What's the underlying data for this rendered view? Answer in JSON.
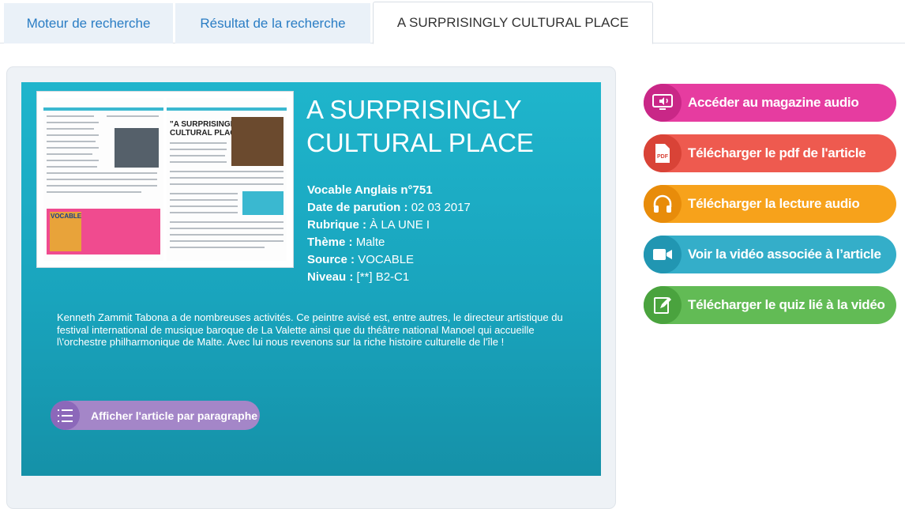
{
  "tabs": {
    "search_engine": "Moteur de recherche",
    "search_results": "Résultat de la recherche",
    "article": "A SURPRISINGLY CULTURAL PLACE"
  },
  "article": {
    "title": "A SURPRISINGLY CULTURAL PLACE",
    "meta": {
      "publication_label": "Vocable Anglais n°751",
      "date_label": "Date de parution :",
      "date_value": "02 03 2017",
      "rubric_label": "Rubrique :",
      "rubric_value": "À LA UNE I",
      "theme_label": "Thème :",
      "theme_value": "Malte",
      "source_label": "Source :",
      "source_value": "VOCABLE",
      "level_label": "Niveau :",
      "level_value": "[**] B2-C1"
    },
    "summary": "Kenneth Zammit Tabona a de nombreuses activités. Ce peintre avisé est, entre autres, le directeur artistique du festival international de musique baroque de La Valette ainsi que du théâtre national Manoel qui accueille l\\'orchestre philharmonique de Malte. Avec lui nous revenons sur la riche histoire culturelle de l'île !",
    "paragraph_button": "Afficher l'article par paragraphe",
    "thumbnail": {
      "headline_line1": "\"A SURPRISINGLY",
      "headline_line2": "CULTURAL PLACE\"",
      "mag_logo": "VOCABLE"
    }
  },
  "actions": [
    {
      "label": "Accéder au magazine audio",
      "icon": "monitor-audio-icon",
      "color": "#e63ca0",
      "dark": "#c92787"
    },
    {
      "label": "Télécharger le pdf de l'article",
      "icon": "pdf-icon",
      "color": "#ee5a4f",
      "dark": "#d94337"
    },
    {
      "label": "Télécharger la lecture audio",
      "icon": "headphones-icon",
      "color": "#f7a21b",
      "dark": "#e88c0a"
    },
    {
      "label": "Voir la vidéo associée à l’article",
      "icon": "video-camera-icon",
      "color": "#34aec9",
      "dark": "#2196b2"
    },
    {
      "label": "Télécharger le quiz lié à la vidéo",
      "icon": "quiz-edit-icon",
      "color": "#62bb55",
      "dark": "#4aa33e"
    }
  ]
}
